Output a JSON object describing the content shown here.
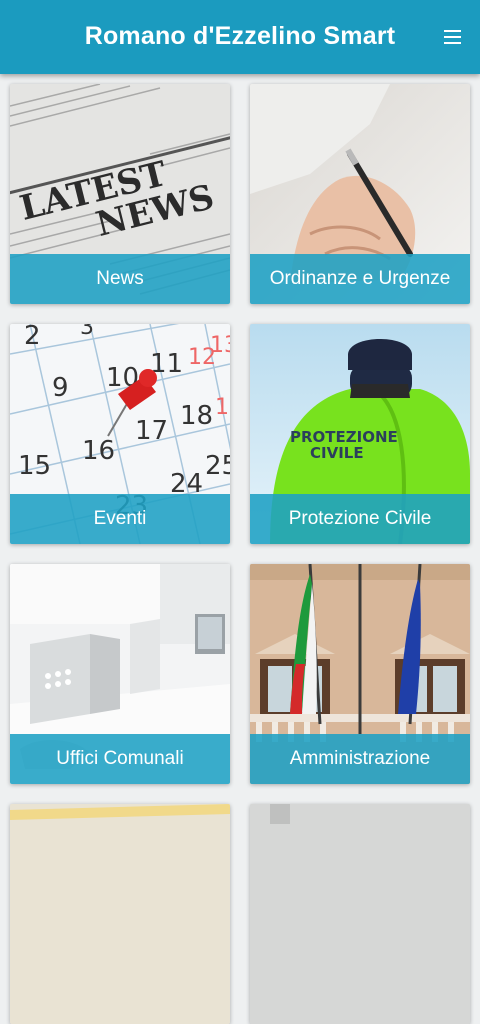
{
  "app_bar": {
    "title": "Romano d'Ezzelino Smart",
    "menu_icon": "hamburger-menu-icon"
  },
  "tiles": [
    {
      "label": "News",
      "image": "newspaper-latest-news"
    },
    {
      "label": "Ordinanze e Urgenze",
      "image": "hand-writing-pen"
    },
    {
      "label": "Eventi",
      "image": "calendar-red-pin"
    },
    {
      "label": "Protezione Civile",
      "image": "civil-protection-jacket"
    },
    {
      "label": "Uffici Comunali",
      "image": "office-desk"
    },
    {
      "label": "Amministrazione",
      "image": "building-flags"
    }
  ],
  "image_text": {
    "news_headline": "LATEST NEWS",
    "jacket_text": "PROTEZIONE CIVILE"
  },
  "colors": {
    "primary": "#1b9bbf",
    "label_bar": "#1ea0c4",
    "background": "#eef0f1"
  }
}
